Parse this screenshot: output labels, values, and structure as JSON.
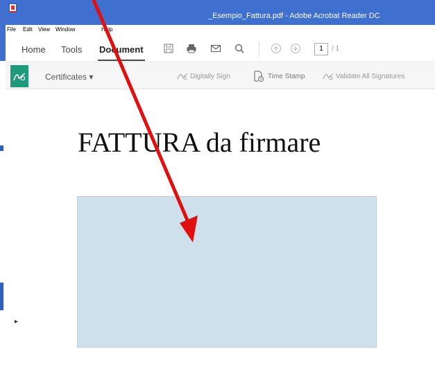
{
  "window": {
    "title": "_Esempio_Fattura.pdf - Adobe Acrobat Reader DC"
  },
  "menu": [
    "File",
    "Edit",
    "View",
    "Window",
    "Help"
  ],
  "tabs": {
    "home": "Home",
    "tools": "Tools",
    "document": "Document"
  },
  "toolbar_icons": [
    "save-icon",
    "print-icon",
    "email-icon",
    "search-icon",
    "page-up-icon",
    "page-down-icon"
  ],
  "pagination": {
    "current": "1",
    "total": "/ 1"
  },
  "certificates": {
    "label": "Certificates ▾",
    "digitally_sign": "Digitally Sign",
    "time_stamp": "Time Stamp",
    "validate": "Validate All Signatures"
  },
  "document": {
    "heading": "FATTURA da firmare"
  },
  "colors": {
    "title_bar": "#3f6fcf",
    "cert_accent": "#1f9a7a",
    "signature_field": "#cde0ec",
    "arrow": "#e01010"
  }
}
